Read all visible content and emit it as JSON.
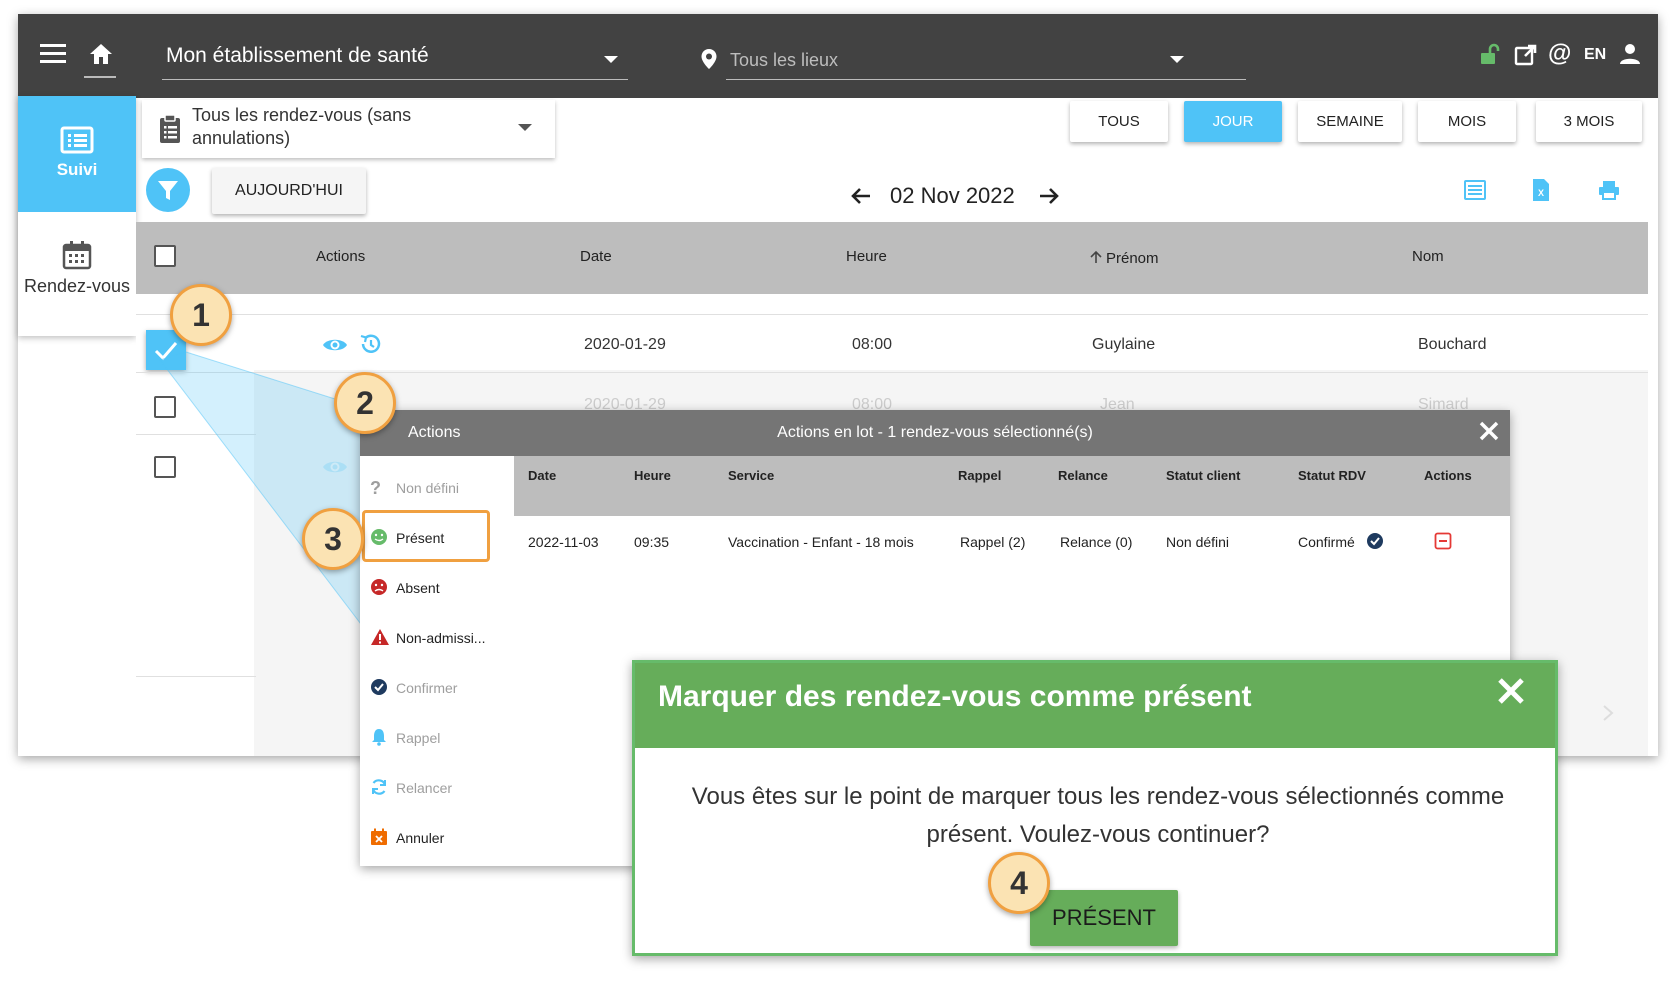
{
  "topbar": {
    "establishment": "Mon établissement de santé",
    "location_placeholder": "Tous les lieux",
    "language": "EN",
    "icons": [
      "menu-icon",
      "home-icon",
      "location-pin-icon",
      "unlock-icon",
      "external-link-icon",
      "at-icon",
      "user-icon"
    ]
  },
  "sidebar": {
    "items": [
      {
        "label": "Suivi",
        "icon": "list-icon",
        "active": true
      },
      {
        "label": "Rendez-vous",
        "icon": "calendar-icon",
        "active": false
      }
    ]
  },
  "filter": {
    "label": "Tous les rendez-vous (sans annulations)"
  },
  "periods": [
    "TOUS",
    "JOUR",
    "SEMAINE",
    "MOIS",
    "3 MOIS"
  ],
  "active_period": "JOUR",
  "toolbar": {
    "today": "AUJOURD'HUI",
    "current_date": "02 Nov 2022"
  },
  "table": {
    "columns": [
      "Actions",
      "Date",
      "Heure",
      "Prénom",
      "Nom"
    ],
    "sort_column": "Prénom",
    "rows": [
      {
        "date": "2020-01-29",
        "time": "08:00",
        "first": "Guylaine",
        "last": "Bouchard",
        "checked": true
      },
      {
        "date": "2020-01-29",
        "time": "08:00",
        "first": "Jean",
        "last": "Simard",
        "checked": false
      },
      {
        "date": "",
        "time": "",
        "first": "",
        "last": "",
        "checked": false
      }
    ]
  },
  "bulk": {
    "menu_title": "Actions",
    "title": "Actions en lot - 1 rendez-vous sélectionné(s)",
    "menu": [
      {
        "label": "Non défini",
        "icon": "question-icon",
        "dim": true
      },
      {
        "label": "Présent",
        "icon": "smile-icon",
        "dim": false
      },
      {
        "label": "Absent",
        "icon": "sad-icon",
        "dim": false
      },
      {
        "label": "Non-admissi...",
        "icon": "warning-icon",
        "dim": false
      },
      {
        "label": "Confirmer",
        "icon": "check-circle-icon",
        "dim": true
      },
      {
        "label": "Rappel",
        "icon": "bell-icon",
        "dim": true
      },
      {
        "label": "Relancer",
        "icon": "refresh-icon",
        "dim": true
      },
      {
        "label": "Annuler",
        "icon": "calendar-x-icon",
        "dim": false
      }
    ],
    "columns": [
      "Date",
      "Heure",
      "Service",
      "Rappel",
      "Relance",
      "Statut client",
      "Statut RDV",
      "Actions"
    ],
    "row": {
      "date": "2022-11-03",
      "time": "09:35",
      "service": "Vaccination - Enfant - 18 mois",
      "rappel": "Rappel (2)",
      "relance": "Relance (0)",
      "client_status": "Non défini",
      "rdv_status": "Confirmé"
    }
  },
  "dialog": {
    "title": "Marquer des rendez-vous comme présent",
    "message": "Vous êtes sur le point de marquer tous les rendez-vous sélectionnés comme présent. Voulez-vous continuer?",
    "button": "PRÉSENT"
  },
  "callouts": [
    "1",
    "2",
    "3",
    "4"
  ],
  "colors": {
    "topbar": "#424242",
    "accent": "#4fc3f7",
    "success": "#66ad5a",
    "callout_border": "#f0a040",
    "callout_fill": "#fbe3b3"
  }
}
